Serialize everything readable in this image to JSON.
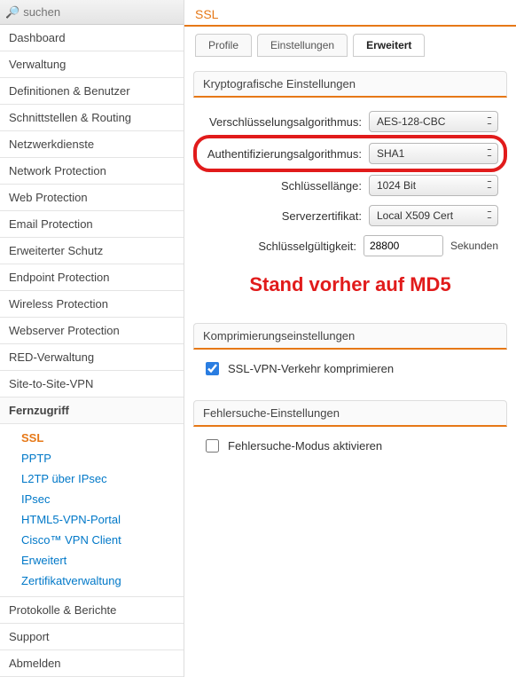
{
  "search": {
    "placeholder": "suchen"
  },
  "nav": [
    "Dashboard",
    "Verwaltung",
    "Definitionen & Benutzer",
    "Schnittstellen & Routing",
    "Netzwerkdienste",
    "Network Protection",
    "Web Protection",
    "Email Protection",
    "Erweiterter Schutz",
    "Endpoint Protection",
    "Wireless Protection",
    "Webserver Protection",
    "RED-Verwaltung",
    "Site-to-Site-VPN"
  ],
  "nav_active": "Fernzugriff",
  "sub": [
    "SSL",
    "PPTP",
    "L2TP über IPsec",
    "IPsec",
    "HTML5-VPN-Portal",
    "Cisco™ VPN Client",
    "Erweitert",
    "Zertifikatverwaltung"
  ],
  "sub_current": "SSL",
  "nav_after": [
    "Protokolle & Berichte",
    "Support",
    "Abmelden"
  ],
  "page": {
    "title": "SSL"
  },
  "tabs": [
    "Profile",
    "Einstellungen",
    "Erweitert"
  ],
  "tab_active": "Erweitert",
  "crypto": {
    "heading": "Kryptografische Einstellungen",
    "enc_label": "Verschlüsselungsalgorithmus:",
    "enc_value": "AES-128-CBC",
    "auth_label": "Authentifizierungsalgorithmus:",
    "auth_value": "SHA1",
    "keysize_label": "Schlüssellänge:",
    "keysize_value": "1024 Bit",
    "cert_label": "Serverzertifikat:",
    "cert_value": "Local X509 Cert",
    "ttl_label": "Schlüsselgültigkeit:",
    "ttl_value": "28800",
    "ttl_unit": "Sekunden"
  },
  "annotation": "Stand vorher auf MD5",
  "compress": {
    "heading": "Komprimierungseinstellungen",
    "label": "SSL-VPN-Verkehr komprimieren",
    "checked": true
  },
  "debug": {
    "heading": "Fehlersuche-Einstellungen",
    "label": "Fehlersuche-Modus aktivieren",
    "checked": false
  }
}
